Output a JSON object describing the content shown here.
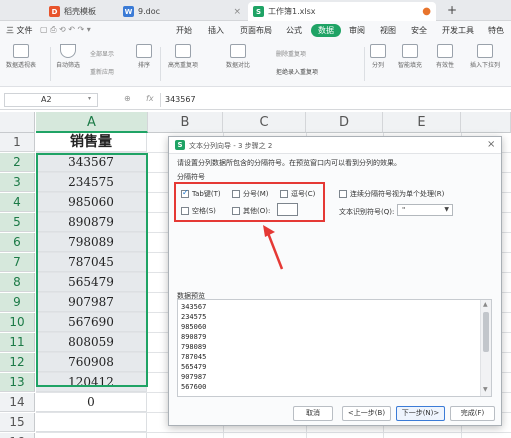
{
  "tabs": [
    {
      "label": "稻壳模板",
      "color": "#e8542c",
      "icon": "D",
      "closable": false
    },
    {
      "label": "9.doc",
      "color": "#3b7bd6",
      "icon": "W",
      "closable": true
    },
    {
      "label": "工作簿1.xlsx",
      "color": "#1fa365",
      "icon": "S",
      "active": true,
      "modified": true
    }
  ],
  "menu": {
    "file": "三 文件",
    "items": [
      "开始",
      "插入",
      "页面布局",
      "公式",
      "数据",
      "审阅",
      "视图",
      "安全",
      "开发工具",
      "特色"
    ],
    "active": "数据"
  },
  "ribbon": {
    "pivot": "数据透视表",
    "auto_filter": "自动筛选",
    "show_all": "全部显示",
    "reapply": "重新应用",
    "sort": "排序",
    "highlight_dup": "高亮重复项",
    "data_compare": "数据对比",
    "remove_dup": "删除重复项",
    "reject_dup": "拒绝录入重复项",
    "split": "分列",
    "smart_fill": "智能填充",
    "validity": "有效性",
    "insert_dropdown": "插入下拉列"
  },
  "formula_bar": {
    "name_box": "A2",
    "fx": "fx",
    "value": "343567"
  },
  "columns": [
    "A",
    "B",
    "C",
    "D",
    "E"
  ],
  "rows": [
    "1",
    "2",
    "3",
    "4",
    "5",
    "6",
    "7",
    "8",
    "9",
    "10",
    "11",
    "12",
    "13",
    "14",
    "15",
    "16"
  ],
  "cells_A": [
    "销售量",
    "343567",
    "234575",
    "985060",
    "890879",
    "798089",
    "787045",
    "565479",
    "907987",
    "567690",
    "808059",
    "760908",
    "120412",
    "0",
    "",
    ""
  ],
  "dialog": {
    "title": "文本分列向导 - 3 步骤之 2",
    "instruction": "请设置分列数据所包含的分隔符号。在预览窗口内可以看到分列的效果。",
    "group_label": "分隔符号",
    "tab": "Tab键(T)",
    "semicolon": "分号(M)",
    "comma": "逗号(C)",
    "space": "空格(S)",
    "other": "其他(O):",
    "consecutive": "连续分隔符号视为单个处理(R)",
    "qualifier_label": "文本识别符号(Q):",
    "qualifier_value": "\"",
    "preview_label": "数据预览",
    "preview_lines": [
      "343567",
      "234575",
      "985060",
      "890879",
      "798089",
      "787045",
      "565479",
      "907987",
      "567600"
    ],
    "cancel": "取消",
    "back": "<上一步(B)",
    "next": "下一步(N)>",
    "finish": "完成(F)",
    "tab_checked": true
  },
  "colors": {
    "accent": "#1fa365",
    "highlight": "#e53935"
  }
}
